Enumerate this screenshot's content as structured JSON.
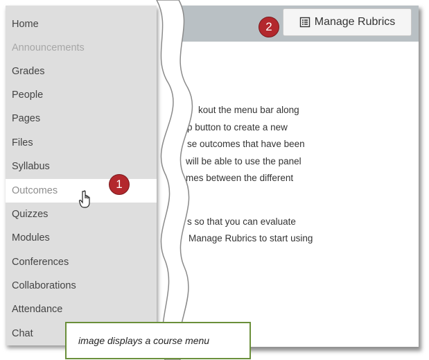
{
  "sidebar": {
    "items": [
      {
        "label": "Home",
        "state": "normal"
      },
      {
        "label": "Announcements",
        "state": "disabled"
      },
      {
        "label": "Grades",
        "state": "normal"
      },
      {
        "label": "People",
        "state": "normal"
      },
      {
        "label": "Pages",
        "state": "normal"
      },
      {
        "label": "Files",
        "state": "normal"
      },
      {
        "label": "Syllabus",
        "state": "normal"
      },
      {
        "label": "Outcomes",
        "state": "active"
      },
      {
        "label": "Quizzes",
        "state": "normal"
      },
      {
        "label": "Modules",
        "state": "normal"
      },
      {
        "label": "Conferences",
        "state": "normal"
      },
      {
        "label": "Collaborations",
        "state": "normal"
      },
      {
        "label": "Attendance",
        "state": "normal"
      },
      {
        "label": "Chat",
        "state": "normal"
      }
    ]
  },
  "header": {
    "manage_rubrics_label": "Manage Rubrics",
    "manage_rubrics_icon": "rubric-list-icon"
  },
  "callouts": {
    "badge_1": "1",
    "badge_2": "2"
  },
  "content": {
    "lines": [
      "kout the menu bar along",
      "p button to create a new",
      "se outcomes that have been",
      "will be able to use the panel",
      "mes between the different",
      "s so that you can evaluate",
      "Manage Rubrics to start using"
    ]
  },
  "caption": {
    "text": "image displays a course menu"
  },
  "colors": {
    "sidebar_bg": "#dedede",
    "topbar_bg": "#b9c0c4",
    "badge_red": "#b3282d",
    "caption_border": "#6a8f3a"
  }
}
